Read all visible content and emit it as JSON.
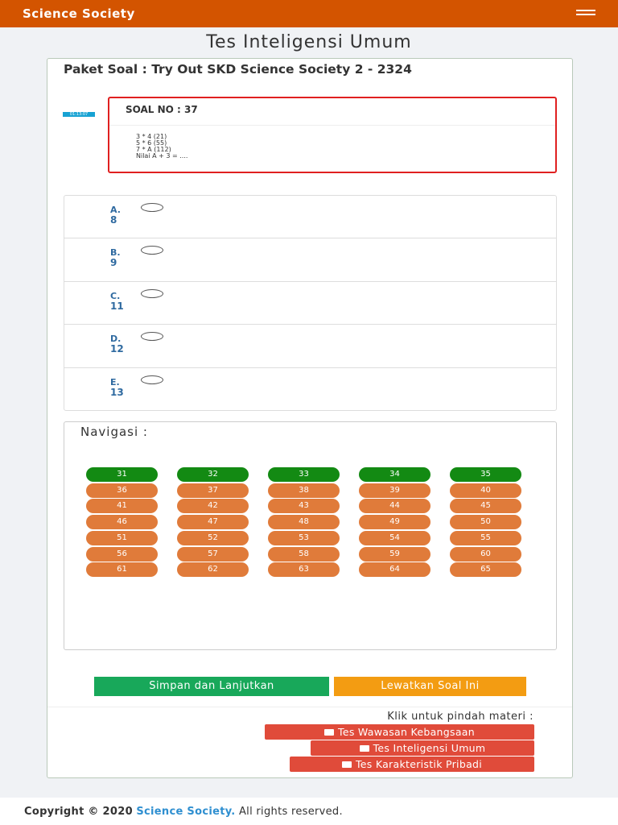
{
  "header": {
    "brand": "Science Society",
    "menu_icon": "hamburger-icon"
  },
  "page_title": "Tes Inteligensi Umum",
  "paket_title": "Paket Soal : Try Out SKD Science Society 2 - 2324",
  "timer": "01:13:07",
  "question": {
    "number_label": "SOAL NO : 37",
    "lines": [
      "3 * 4 (21)",
      "5 * 6 (55)",
      "7 * A (112)",
      "Nilai A + 3 = ...."
    ]
  },
  "options": [
    {
      "letter": "A.",
      "value": "8"
    },
    {
      "letter": "B.",
      "value": "9"
    },
    {
      "letter": "C.",
      "value": "11"
    },
    {
      "letter": "D.",
      "value": "12"
    },
    {
      "letter": "E.",
      "value": "13"
    }
  ],
  "navigation": {
    "title": "Navigasi :",
    "numbers": [
      "31",
      "32",
      "33",
      "34",
      "35",
      "36",
      "37",
      "38",
      "39",
      "40",
      "41",
      "42",
      "43",
      "44",
      "45",
      "46",
      "47",
      "48",
      "49",
      "50",
      "51",
      "52",
      "53",
      "54",
      "55",
      "56",
      "57",
      "58",
      "59",
      "60",
      "61",
      "62",
      "63",
      "64",
      "65"
    ],
    "answered": [
      "31",
      "32",
      "33",
      "34",
      "35"
    ],
    "colors": {
      "answered": "#138a13",
      "unanswered": "#e07b3a"
    }
  },
  "actions": {
    "save": "Simpan dan Lanjutkan",
    "skip": "Lewatkan Soal Ini"
  },
  "pindah": {
    "label": "Klik untuk pindah materi :",
    "items": [
      "Tes Wawasan Kebangsaan",
      "Tes Inteligensi Umum",
      "Tes Karakteristik Pribadi"
    ]
  },
  "footer": {
    "prefix": "Copyright © 2020",
    "brand": "Science Society.",
    "suffix": "All rights reserved."
  },
  "colors": {
    "topbar": "#d35400",
    "save": "#18a85a",
    "skip": "#f39c12",
    "materi": "#e04b3a",
    "accent": "#2f6aa0"
  }
}
